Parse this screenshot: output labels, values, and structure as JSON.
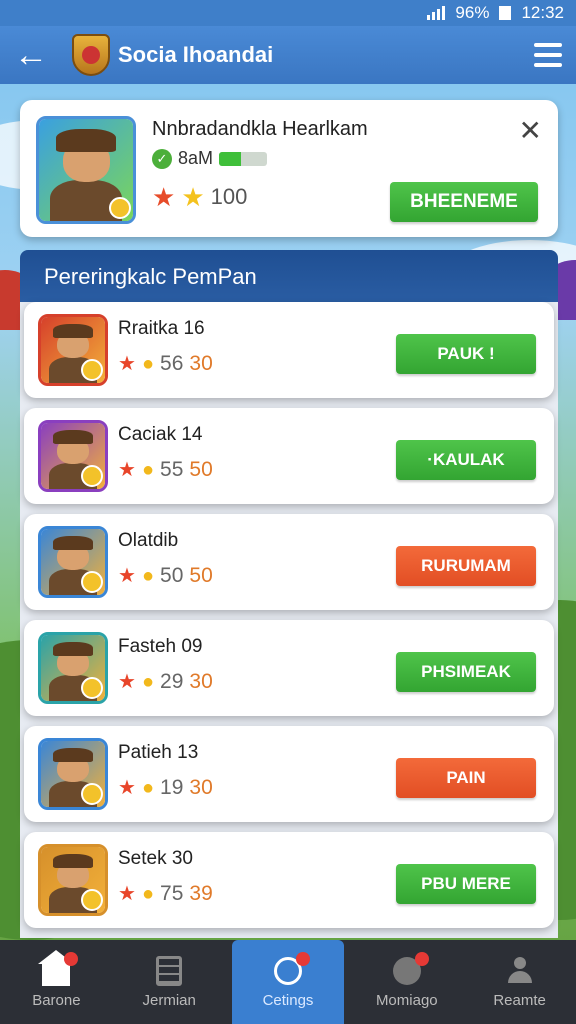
{
  "status_bar": {
    "battery_pct": "96%",
    "time": "12:32"
  },
  "app_bar": {
    "title": "Socia Ihoandai"
  },
  "top_card": {
    "name": "Nnbradandkla Hearlkam",
    "time": "8aM",
    "progress": 0.45,
    "score": "100",
    "button_label": "BHEENEME"
  },
  "section": {
    "title": "Pereringkalc PemPan"
  },
  "rows": [
    {
      "name": "Rraitka 16",
      "value": "56",
      "points": "30",
      "button_label": "PAUK !",
      "button_color": "green",
      "avatar_color": "#d6402b"
    },
    {
      "name": "Caciak 14",
      "value": "55",
      "points": "50",
      "button_label": "·KAULAK",
      "button_color": "green",
      "avatar_color": "#8a3fbf"
    },
    {
      "name": "Olatdib",
      "value": "50",
      "points": "50",
      "button_label": "RURUMAM",
      "button_color": "orange",
      "avatar_color": "#3a86d6"
    },
    {
      "name": "Fasteh 09",
      "value": "29",
      "points": "30",
      "button_label": "PHSIMEAK",
      "button_color": "green",
      "avatar_color": "#2aa3a8"
    },
    {
      "name": "Patieh 13",
      "value": "19",
      "points": "30",
      "button_label": "PAIN",
      "button_color": "orange",
      "avatar_color": "#3a86d6"
    },
    {
      "name": "Setek 30",
      "value": "75",
      "points": "39",
      "button_label": "PBU MERE",
      "button_color": "green",
      "avatar_color": "#d6902b"
    }
  ],
  "nav": [
    {
      "label": "Barone",
      "icon": "home-icon"
    },
    {
      "label": "Jermian",
      "icon": "document-icon"
    },
    {
      "label": "Cetings",
      "icon": "settings-icon"
    },
    {
      "label": "Momiago",
      "icon": "globe-icon"
    },
    {
      "label": "Reamte",
      "icon": "profile-icon"
    }
  ],
  "colors": {
    "primary": "#3a76c2",
    "green_button": "#3fb33c",
    "orange_button": "#e8572a"
  }
}
